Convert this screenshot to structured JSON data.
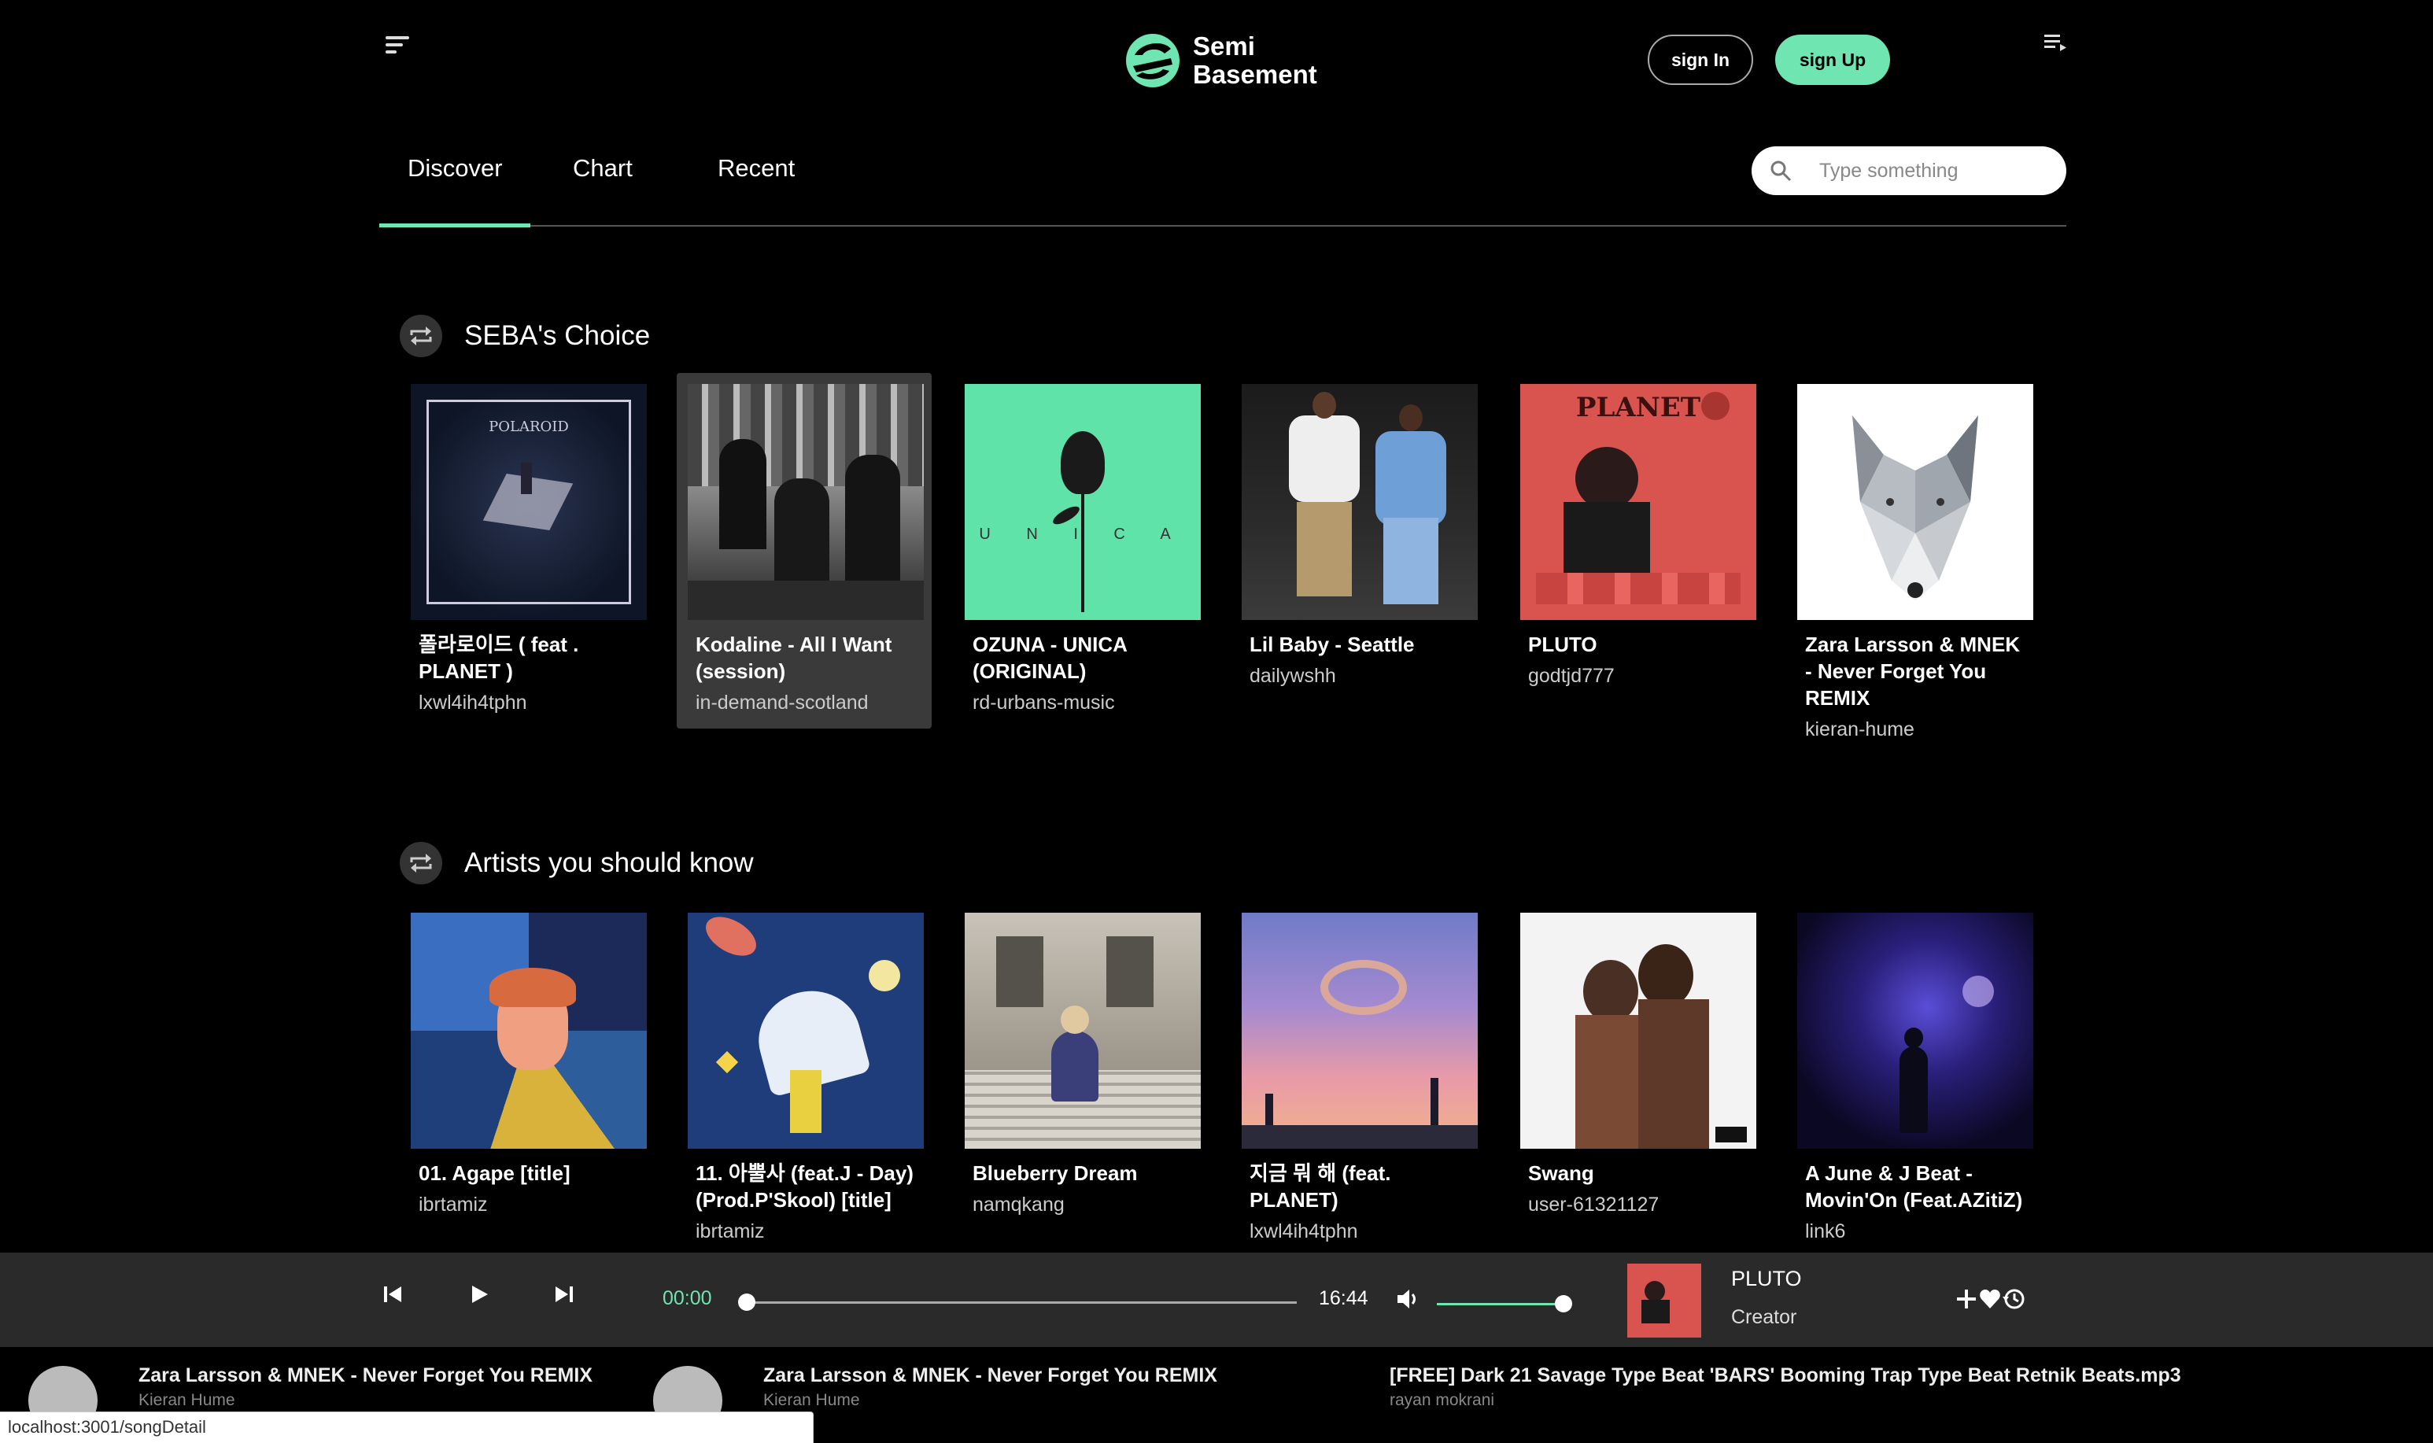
{
  "app": {
    "logo_line1": "Semi",
    "logo_line2": "Basement",
    "brand_color": "#6fe5b1"
  },
  "header": {
    "signin_label": "sign In",
    "signup_label": "sign Up"
  },
  "tabs": [
    {
      "label": "Discover",
      "active": true
    },
    {
      "label": "Chart",
      "active": false
    },
    {
      "label": "Recent",
      "active": false
    }
  ],
  "search": {
    "placeholder": "Type something"
  },
  "sections": [
    {
      "title": "SEBA's Choice",
      "items": [
        {
          "title": "폴라로이드 ( feat . PLANET )",
          "artist": "lxwl4ih4tphn",
          "cover_text": "POLAROID"
        },
        {
          "title": "Kodaline - All I Want (session)",
          "artist": "in-demand-scotland",
          "active": true
        },
        {
          "title": "OZUNA - UNICA (ORIGINAL)",
          "artist": "rd-urbans-music",
          "cover_text": "U N I C A"
        },
        {
          "title": "Lil Baby - Seattle",
          "artist": "dailywshh"
        },
        {
          "title": "PLUTO",
          "artist": "godtjd777",
          "cover_text": "PLANET"
        },
        {
          "title": "Zara Larsson & MNEK - Never Forget You REMIX",
          "artist": "kieran-hume"
        }
      ]
    },
    {
      "title": "Artists you should know",
      "items": [
        {
          "title": "01. Agape [title]",
          "artist": "ibrtamiz"
        },
        {
          "title": "11. 아뿔사 (feat.J - Day) (Prod.P'Skool) [title]",
          "artist": "ibrtamiz"
        },
        {
          "title": "Blueberry Dream",
          "artist": "namqkang"
        },
        {
          "title": "지금 뭐 해 (feat. PLANET)",
          "artist": "lxwl4ih4tphn"
        },
        {
          "title": "Swang",
          "artist": "user-61321127"
        },
        {
          "title": "A June & J Beat - Movin'On (Feat.AZitiZ)",
          "artist": "link6"
        }
      ]
    }
  ],
  "player": {
    "current_time": "00:00",
    "total_time": "16:44",
    "progress": 0.0,
    "volume": 1.0,
    "now_playing_title": "PLUTO",
    "now_playing_sub": "Creator"
  },
  "strip": [
    {
      "title": "Zara Larsson & MNEK - Never Forget You REMIX",
      "sub": "Kieran Hume"
    },
    {
      "title": "Zara Larsson & MNEK - Never Forget You REMIX",
      "sub": "Kieran Hume"
    },
    {
      "title": "[FREE] Dark 21 Savage Type Beat 'BARS' Booming Trap Type Beat Retnik Beats.mp3",
      "sub": "rayan mokrani"
    }
  ],
  "status_url": "localhost:3001/songDetail"
}
